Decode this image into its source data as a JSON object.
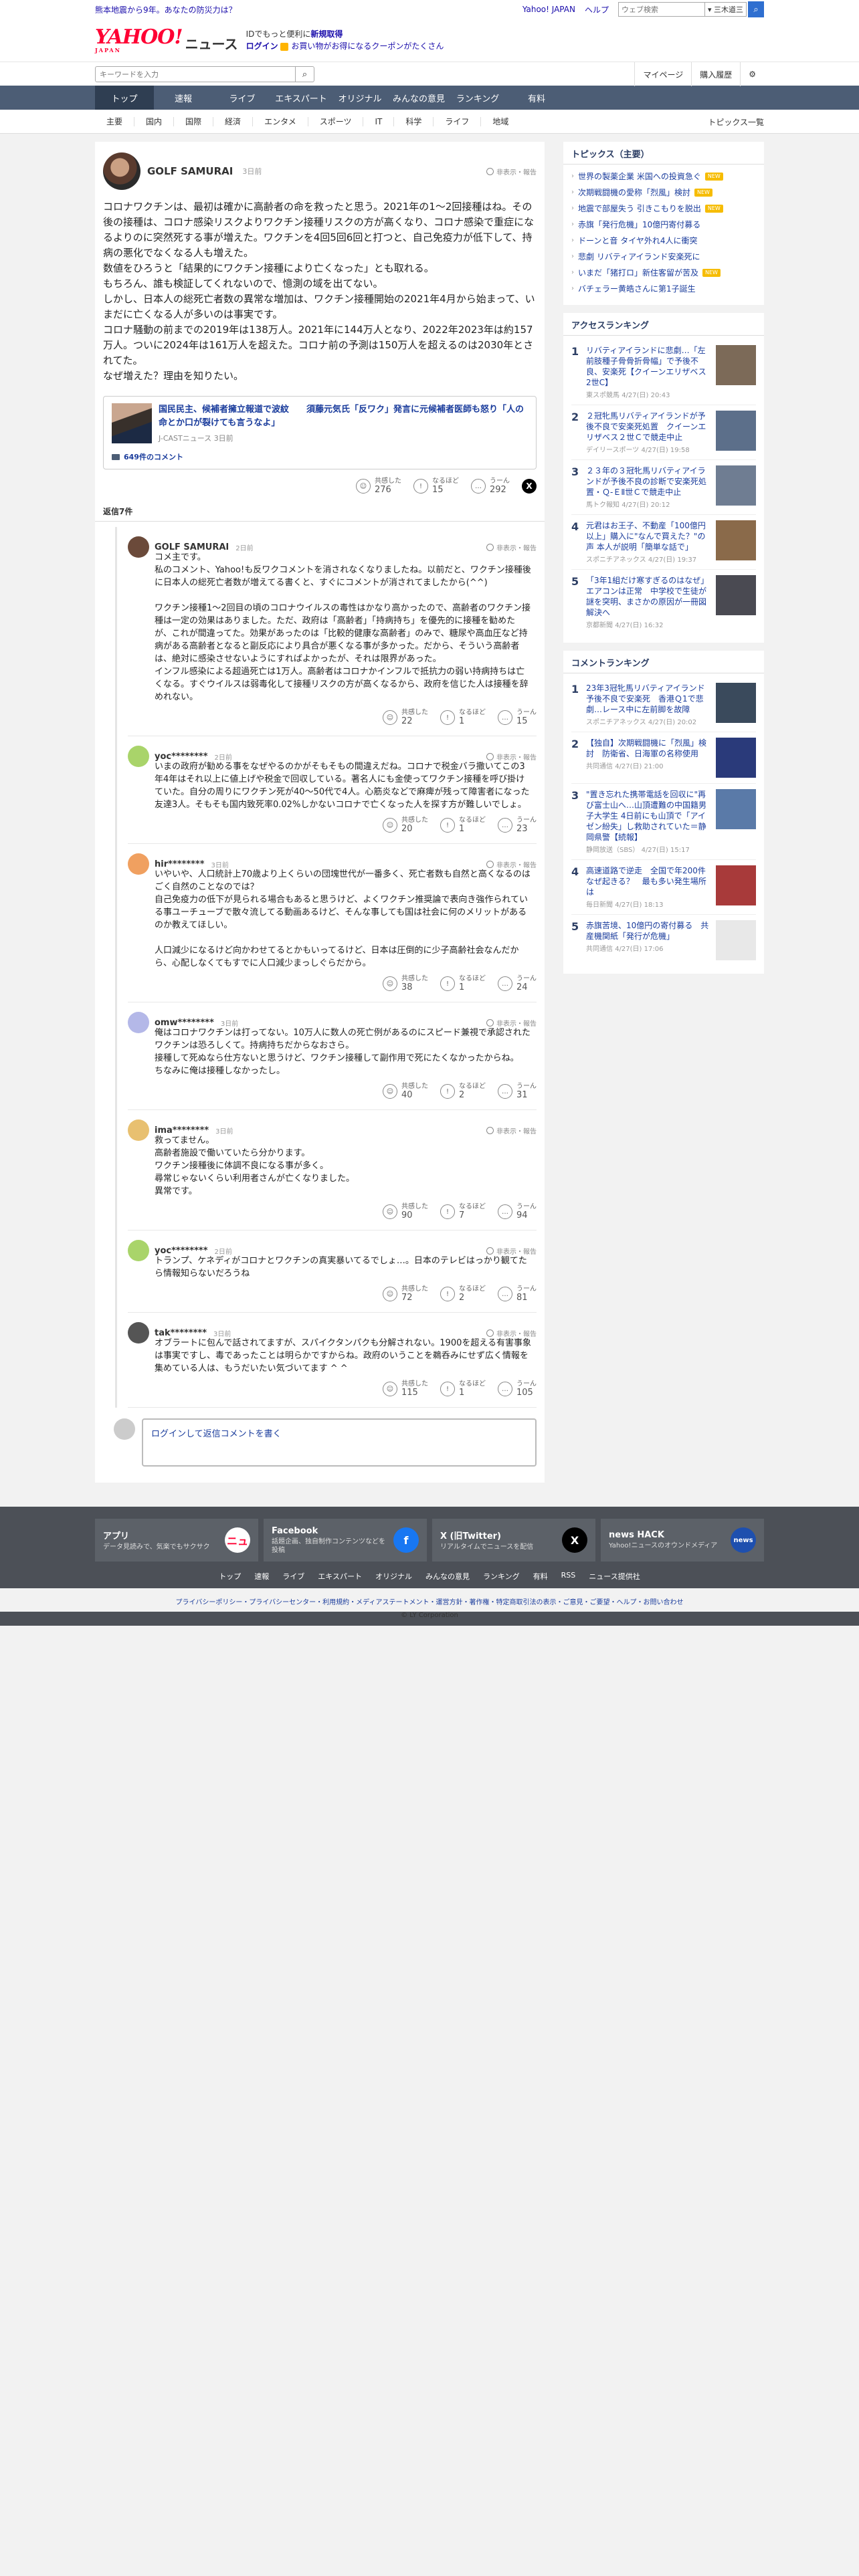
{
  "topbar": {
    "notice": "熊本地震から9年。あなたの防災力は？",
    "links": [
      "Yahoo! JAPAN",
      "ヘルプ"
    ],
    "web_search_placeholder": "ウェブ検索",
    "search_chip": "▾ 三木道三",
    "search_icon": "search-icon"
  },
  "masthead": {
    "logo_main": "YAHOO!",
    "logo_sub": "JAPAN",
    "logo_news": "ニュース",
    "promo_line1_prefix": "IDでもっと便利に",
    "promo_line1_link": "新規取得",
    "promo_line2_login": "ログイン",
    "promo_line2_text": "お買い物がお得になるクーポンがたくさん"
  },
  "searchrow": {
    "placeholder": "キーワードを入力",
    "buttons": [
      "マイページ",
      "購入履歴"
    ],
    "settings_icon": "gear-icon"
  },
  "nav": {
    "items": [
      "トップ",
      "速報",
      "ライブ",
      "エキスパート",
      "オリジナル",
      "みんなの意見",
      "ランキング",
      "有料"
    ],
    "active": 0
  },
  "subnav": {
    "items": [
      "主要",
      "国内",
      "国際",
      "経済",
      "エンタメ",
      "スポーツ",
      "IT",
      "科学",
      "ライフ",
      "地域"
    ],
    "right": "トピックス一覧"
  },
  "comment": {
    "author": "GOLF SAMURAI",
    "time": "3日前",
    "report_label": "非表示・報告",
    "paragraphs": [
      "コロナワクチンは、最初は確かに高齢者の命を救ったと思う。2021年の1～2回接種はね。その後の接種は、コロナ感染リスクよりワクチン接種リスクの方が高くなり、コロナ感染で重症になるよりのに突然死する事が増えた。ワクチンを4回5回6回と打つと、自己免疫力が低下して、持病の悪化でなくなる人も増えた。",
      "数値をひろうと「結果的にワクチン接種により亡くなった」とも取れる。",
      "もちろん、誰も検証してくれないので、憶測の域を出てない。",
      "しかし、日本人の総死亡者数の異常な増加は、ワクチン接種開始の2021年4月から始まって、いまだに亡くなる人が多いのは事実です。",
      "コロナ騒動の前までの2019年は138万人。2021年に144万人となり、2022年2023年は約157万人。ついに2024年は161万人を超えた。コロナ前の予測は150万人を超えるのは2030年とされてた。",
      "なぜ増えた？理由を知りたい。"
    ],
    "article": {
      "title": "国民民主、候補者擁立報道で波紋　　須藤元気氏「反ワク」発言に元候補者医師も怒り「人の命とか口が裂けても言うなよ」",
      "source": "J-CASTニュース",
      "source_time": "3日前",
      "comment_count": "649件のコメント"
    },
    "reactions": {
      "empathy_label": "共感した",
      "empathy": "276",
      "naruhodo_label": "なるほど",
      "naruhodo": "15",
      "uun_label": "うーん",
      "uun": "292"
    },
    "reply_count_label": "返信7件"
  },
  "replies": [
    {
      "author": "GOLF SAMURAI",
      "time": "2日前",
      "avatar_color": "#6b4a3a",
      "body": "コメ主です。\n私のコメント、Yahoo!も反ワクコメントを消されなくなりましたね。以前だと、ワクチン接種後に日本人の総死亡者数が増えてる書くと、すぐにコメントが消されてましたから(^^)\n\nワクチン接種1～2回目の頃のコロナウイルスの毒性はかなり高かったので、高齢者のワクチン接種は一定の効果はありました。ただ、政府は「高齢者」「持病持ち」を優先的に接種を勧めたが、これが間違ってた。効果があったのは「比較的健康な高齢者」のみで、糖尿や高血圧など持病がある高齢者となると副反応により具合が悪くなる事が多かった。だから、そういう高齢者は、絶対に感染させないようにすればよかったが、それは限界があった。\nインフル感染による超過死亡は1万人。高齢者はコロナかインフルで抵抗力の弱い持病持ちは亡くなる。すぐウイルスは弱毒化して接種リスクの方が高くなるから、政府を信じた人は接種を辞めれない。",
      "r": [
        "22",
        "1",
        "15"
      ]
    },
    {
      "author": "yoc********",
      "time": "2日前",
      "avatar_color": "#a9d46a",
      "body": "いまの政府が勧める事をなぜやるのかがそもそもの間違えだね。コロナで税金バラ撒いてこの3年4年はそれ以上に値上げや税金で回収している。著名人にも金使ってワクチン接種を呼び掛けていた。自分の周りにワクチン死が40～50代で4人。心筋炎などで麻痺が残って障害者になった友達3人。そもそも国内致死率0.02%しかないコロナで亡くなった人を探す方が難しいでしょ。",
      "r": [
        "20",
        "1",
        "23"
      ]
    },
    {
      "author": "hir********",
      "time": "3日前",
      "avatar_color": "#f0a060",
      "body": "いやいや、人口統計上70歳より上くらいの団塊世代が一番多く、死亡者数も自然と高くなるのはごく自然のことなのでは？\n自己免疫力の低下が見られる場合もあると思うけど、よくワクチン推奨論で表向き強作られている事ユーチューブで散々流してる動画あるけど、そんな事しても国は社会に何のメリットがあるのか教えてほしい。\n\n人口減少になるけど向かわせてるとかもいってるけど、日本は圧倒的に少子高齢社会なんだから、心配しなくてもすでに人口減少まっしぐらだから。",
      "r": [
        "38",
        "1",
        "24"
      ]
    },
    {
      "author": "omw********",
      "time": "3日前",
      "avatar_color": "#b4b8e8",
      "body": "俺はコロナワクチンは打ってない。10万人に数人の死亡例があるのにスピード兼視で承認されたワクチンは恐ろしくて。持病持ちだからなおさら。\n接種して死ぬなら仕方ないと思うけど、ワクチン接種して副作用で死にたくなかったからね。\nちなみに俺は接種しなかったし。",
      "r": [
        "40",
        "2",
        "31"
      ]
    },
    {
      "author": "ima********",
      "time": "3日前",
      "avatar_color": "#e8c070",
      "body": "救ってません。\n高齢者施設で働いていたら分かります。\nワクチン接種後に体調不良になる事が多く。\n尋常じゃないくらい利用者さんが亡くなりました。\n異常です。",
      "r": [
        "90",
        "7",
        "94"
      ]
    },
    {
      "author": "yoc********",
      "time": "2日前",
      "avatar_color": "#a9d46a",
      "body": "トランプ、ケネディがコロナとワクチンの真実暴いてるでしょ…。日本のテレビはっかり観てたら情報知らないだろうね",
      "r": [
        "72",
        "2",
        "81"
      ]
    },
    {
      "author": "tak********",
      "time": "3日前",
      "avatar_color": "#555555",
      "body": "オブラートに包んで話されてますが、スパイクタンパクも分解されない。1900を超える有害事象は事実ですし、毒であったことは明らかですからね。政府のいうことを鵜呑みにせず広く情報を集めている人は、もうだいたい気づいてます ^ ^",
      "r": [
        "115",
        "1",
        "105"
      ]
    }
  ],
  "login_reply": "ログインして返信コメントを書く",
  "sidebar": {
    "topics_title": "トピックス（主要）",
    "topics": [
      {
        "t": "世界の製薬企業 米国への投資急ぐ",
        "new": true
      },
      {
        "t": "次期戦闘機の愛称「烈風」検討",
        "new": true
      },
      {
        "t": "地震で部屋失う 引きこもりを脱出",
        "new": true
      },
      {
        "t": "赤旗「発行危機」10億円寄付募る",
        "new": false
      },
      {
        "t": "ドーンと音 タイヤ外れ4人に衝突",
        "new": false
      },
      {
        "t": "悲劇 リバティアイランド安楽死に",
        "new": false
      },
      {
        "t": "いまだ「猪打ロ」新住客留が苦及",
        "new": true
      },
      {
        "t": "バチェラー黄皓さんに第1子誕生",
        "new": false
      }
    ],
    "new_label": "NEW",
    "access_title": "アクセスランキング",
    "access": [
      {
        "title": "リバティアイランドに悲劇…「左前肢種子骨骨折骨幅」で予後不良、安楽死【クイーンエリザベス2世C】",
        "src": "東スポ競馬",
        "time": "4/27(日) 20:43",
        "thumb": "#7c6a58"
      },
      {
        "title": "２冠牝馬リバティアイランドが予後不良で安楽死処置　クイーンエリザベス２世Ｃで競走中止",
        "src": "デイリースポーツ",
        "time": "4/27(日) 19:58",
        "thumb": "#5c6f8a"
      },
      {
        "title": "２３年の３冠牝馬リバティアイランドが予後不良の診断で安楽死処置・Ｑ-ＥⅡ世Ｃで競走中止",
        "src": "馬トク報知",
        "time": "4/27(日) 20:12",
        "thumb": "#6f7d92"
      },
      {
        "title": "元君はお王子、不動産「100億円以上」購入に\"なんで買えた？\"の声 本人が説明「簡単な話で」",
        "src": "スポニチアネックス",
        "time": "4/27(日) 19:37",
        "thumb": "#8a6a4a"
      },
      {
        "title": "「3年1組だけ寒すぎるのはなぜ」エアコンは正常　中学校で生徒が謎を突明、まさかの原因が一冊図解決へ",
        "src": "京都新聞",
        "time": "4/27(日) 16:32",
        "thumb": "#4a4a52"
      }
    ],
    "comment_title": "コメントランキング",
    "comments": [
      {
        "title": "23年3冠牝馬リバティアイランド予後不良で安楽死　香港Ｑ1で悲劇…レース中に左前脚を故障",
        "src": "スポニチアネックス",
        "time": "4/27(日) 20:02",
        "thumb": "#3a4a5c"
      },
      {
        "title": "【独自】次期戦闘機に「烈風」検討　防衛省、日海軍の名称使用",
        "src": "共同通信",
        "time": "4/27(日) 21:00",
        "thumb": "#2a3a7a"
      },
      {
        "title": "\"置き忘れた携帯電話を回収に\"再び富士山へ…山頂遭難の中国籍男子大学生 4日前にも山頂で「アイゼン紛失」し救助されていた＝静岡県警【続報】",
        "src": "静岡放送（SBS）",
        "time": "4/27(日) 15:17",
        "thumb": "#5a7aa8"
      },
      {
        "title": "高速道路で逆走　全国で年200件なぜ起きる？　最も多い発生場所は",
        "src": "毎日新聞",
        "time": "4/27(日) 18:13",
        "thumb": "#a83a3a"
      },
      {
        "title": "赤旗苦境、10億円の寄付募る　共産機関紙「発行が危機」",
        "src": "共同通信",
        "time": "4/27(日) 17:06",
        "thumb": "#e8e8e8"
      }
    ]
  },
  "footer": {
    "cards": [
      {
        "name": "アプリ",
        "desc": "データ見読みで、気楽でもサクサク",
        "icon": "app-icon",
        "color": "#ffffff",
        "fg": "#ff0033",
        "glyph": "ニュ"
      },
      {
        "name": "Facebook",
        "desc": "話題企画、独自制作コンテンツなどを投稿",
        "icon": "facebook-icon",
        "color": "#1877f2",
        "fg": "#ffffff",
        "glyph": "f"
      },
      {
        "name": "X (旧Twitter)",
        "desc": "リアルタイムでニュースを配信",
        "icon": "x-icon",
        "color": "#000000",
        "fg": "#ffffff",
        "glyph": "X"
      },
      {
        "name": "news HACK",
        "desc": "Yahoo!ニュースのオウンドメディア",
        "icon": "newshack-icon",
        "color": "#1e4fae",
        "fg": "#ffffff",
        "glyph": "news"
      }
    ],
    "links": [
      "トップ",
      "速報",
      "ライブ",
      "エキスパート",
      "オリジナル",
      "みんなの意見",
      "ランキング",
      "有料",
      "RSS",
      "ニュース提供社"
    ],
    "legal": "プライバシーポリシー・プライバシーセンター・利用規約・メディアステートメント・運営方針・著作権・特定商取引法の表示・ご意見・ご要望・ヘルプ・お問い合わせ",
    "copyright": "© LY Corporation"
  }
}
